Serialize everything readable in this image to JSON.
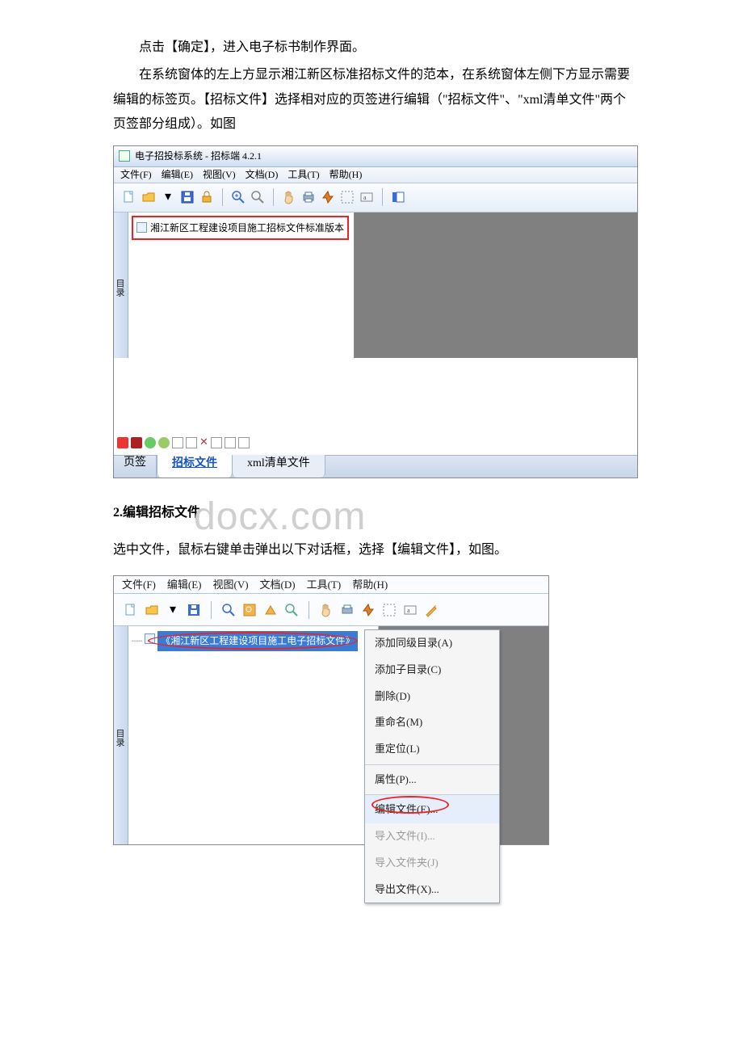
{
  "paragraphs": {
    "p1": "点击【确定】，进入电子标书制作界面。",
    "p2": "在系统窗体的左上方显示湘江新区标准招标文件的范本，在系统窗体左侧下方显示需要编辑的标签页。【招标文件】选择相对应的页签进行编辑（\"招标文件\"、\"xml清单文件\"两个页签部分组成）。如图",
    "h1": "2.编辑招标文件",
    "p3": "选中文件，鼠标右键单击弹出以下对话框，选择【编辑文件】，如图。"
  },
  "watermark_text": "docx.com",
  "fig1": {
    "window_title": "电子招投标系统 - 招标端 4.2.1",
    "menus": [
      "文件(F)",
      "编辑(E)",
      "视图(V)",
      "文档(D)",
      "工具(T)",
      "帮助(H)"
    ],
    "side_label": "目录",
    "tree_node": "湘江新区工程建设项目施工招标文件标准版本",
    "tabstrip_label": "页签",
    "tab_active": "招标文件",
    "tab_inactive": "xml清单文件",
    "toolbar_icons": [
      "new-page-icon",
      "open-folder-icon",
      "dropdown-icon",
      "save-icon",
      "lock-icon",
      "zoom-in-icon",
      "zoom-out-icon",
      "hand-icon",
      "print-icon",
      "stamp-icon",
      "select-icon",
      "text-select-icon",
      "sidebar-toggle-icon"
    ],
    "bottom_icons": [
      "add-icon",
      "remove-icon",
      "up-icon",
      "down-icon",
      "sort-icon",
      "new-folder-icon",
      "delete-x-icon",
      "rename-icon",
      "refresh-icon",
      "expand-icon"
    ]
  },
  "fig2": {
    "menus": [
      "文件(F)",
      "编辑(E)",
      "视图(V)",
      "文档(D)",
      "工具(T)",
      "帮助(H)"
    ],
    "side_label": "目录",
    "tree_node": "《湘江新区工程建设项目施工电子招标文件》",
    "toolbar_icons": [
      "new-page-icon",
      "open-folder-icon",
      "dropdown-icon",
      "save-icon",
      "zoom-in-icon",
      "zoom-sel-icon",
      "print-icon",
      "find-icon",
      "hand-icon",
      "fit-icon",
      "stamp-icon",
      "select-icon",
      "text-select-icon",
      "wand-icon"
    ],
    "context_menu": [
      {
        "label": "添加同级目录(A)",
        "type": "n"
      },
      {
        "label": "添加子目录(C)",
        "type": "n"
      },
      {
        "label": "删除(D)",
        "type": "n"
      },
      {
        "label": "重命名(M)",
        "type": "n"
      },
      {
        "label": "重定位(L)",
        "type": "n"
      },
      {
        "label": "属性(P)...",
        "type": "sep"
      },
      {
        "label": "编辑文件(E)...",
        "type": "sep hi circled"
      },
      {
        "label": "导入文件(I)...",
        "type": "dis"
      },
      {
        "label": "导入文件夹(J)",
        "type": "dis"
      },
      {
        "label": "导出文件(X)...",
        "type": "n"
      }
    ]
  }
}
